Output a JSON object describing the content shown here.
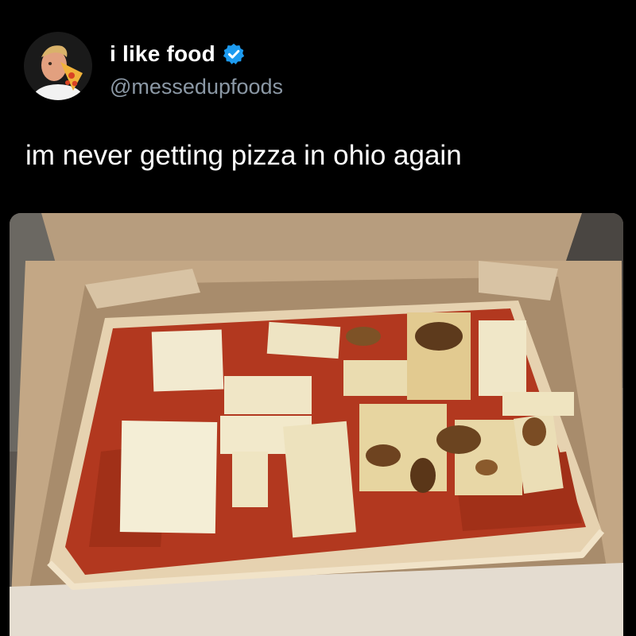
{
  "tweet": {
    "author": {
      "display_name": "i like food",
      "handle": "@messedupfoods",
      "verified": true,
      "avatar_icon": "avatar-chef-eating-pizza"
    },
    "text": "im never getting pizza in ohio again",
    "media": {
      "icon": "photo-pizza-in-box"
    }
  },
  "colors": {
    "background": "#000000",
    "text_primary": "#ffffff",
    "text_secondary": "#8b98a5",
    "verified_badge": "#1d9bf0"
  }
}
